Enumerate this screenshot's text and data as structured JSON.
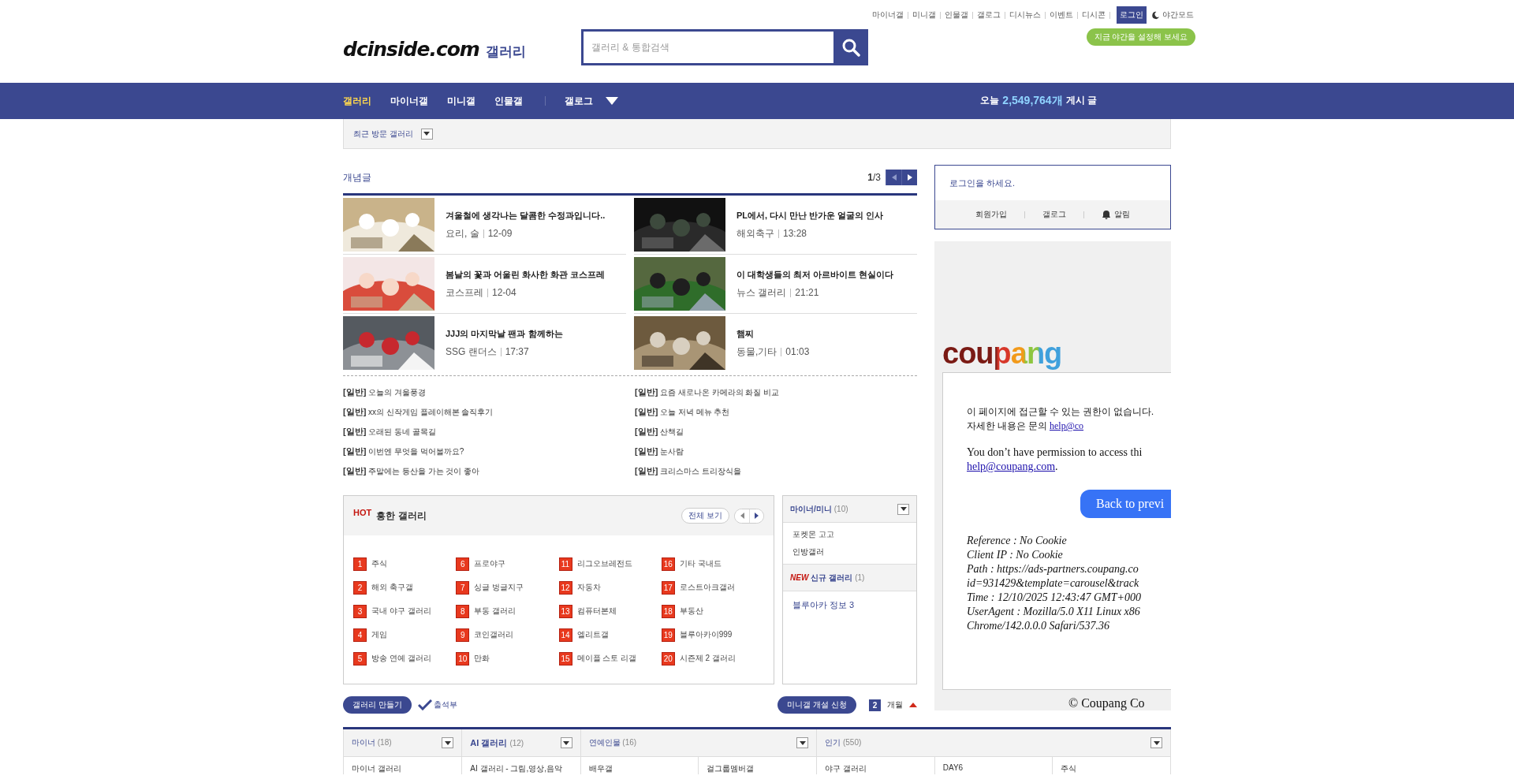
{
  "top_links": [
    "마이너갤",
    "미니갤",
    "인물갤",
    "갤로그",
    "디시뉴스",
    "이벤트",
    "디시콘"
  ],
  "login_button": "로그인",
  "night_mode": {
    "label": "야간모드",
    "on": false
  },
  "tooltip": "지금 야간을 설정해 보세요",
  "logo": {
    "text": "dcinside.com",
    "suffix": "갤러리"
  },
  "search": {
    "placeholder": "갤러리 & 통합검색"
  },
  "nav": {
    "items": [
      {
        "label": "갤러리",
        "selected": true
      },
      {
        "label": "마이너갤",
        "selected": false
      },
      {
        "label": "미니갤",
        "selected": false
      },
      {
        "label": "인물갤",
        "selected": false
      }
    ],
    "more": "갤로그"
  },
  "stats": {
    "prefix": "오늘",
    "count": "2,549,764개",
    "suffix": "게시 글"
  },
  "recent": {
    "label": "최근 방문 갤러리"
  },
  "best": {
    "title": "개념글",
    "page": "1",
    "pages": "/3",
    "cards": [
      {
        "title": "겨울철에 생각나는 달콤한 수정과입니다..",
        "source": "요리, 술",
        "time": "12-09"
      },
      {
        "title": "PL에서, 다시 만난 반가운 얼굴의 인사",
        "source": "해외축구",
        "time": "13:28"
      },
      {
        "title": "봄날의 꽃과 어울린 화사한 화관 코스프레",
        "source": "코스프레",
        "time": "12-04"
      },
      {
        "title": "이 대학생들의 최저 아르바이트 현실이다",
        "source": "뉴스 갤러리",
        "time": "21:21"
      },
      {
        "title": "JJJ의 마지막날 팬과 함께하는",
        "source": "SSG 랜더스",
        "time": "17:37"
      },
      {
        "title": "햄찌",
        "source": "동물,기타",
        "time": "01:03"
      }
    ],
    "headlines": [
      {
        "tag": "[일반]",
        "text": "오늘의 겨울풍경"
      },
      {
        "tag": "[일반]",
        "text": "요즘 새로나온 카메라의 화질 비교"
      },
      {
        "tag": "[일반]",
        "text": "xx의 신작게임 플레이해본 솔직후기"
      },
      {
        "tag": "[일반]",
        "text": "오늘 저녁 메뉴 추천"
      },
      {
        "tag": "[일반]",
        "text": "오래된 동네 골목길"
      },
      {
        "tag": "[일반]",
        "text": "산책길"
      },
      {
        "tag": "[일반]",
        "text": "이번엔 무엇을 먹어볼까요?"
      },
      {
        "tag": "[일반]",
        "text": "눈사람"
      },
      {
        "tag": "[일반]",
        "text": "주말에는 등산을 가는 것이 좋아"
      },
      {
        "tag": "[일반]",
        "text": "크리스마스 트리장식을"
      }
    ]
  },
  "hot": {
    "badge": "HOT",
    "title": "흥한 갤러리",
    "all_button": "전체 보기",
    "items": [
      {
        "rank": "1",
        "name": "주식"
      },
      {
        "rank": "2",
        "name": "해외 축구갤"
      },
      {
        "rank": "3",
        "name": "국내 야구 갤러리"
      },
      {
        "rank": "4",
        "name": "게임"
      },
      {
        "rank": "5",
        "name": "방송 연예 갤러리"
      },
      {
        "rank": "6",
        "name": "프로야구"
      },
      {
        "rank": "7",
        "name": "싱글 벙글지구"
      },
      {
        "rank": "8",
        "name": "부동 갤러리"
      },
      {
        "rank": "9",
        "name": "코인갤러리"
      },
      {
        "rank": "10",
        "name": "만화"
      },
      {
        "rank": "11",
        "name": "리그오브레전드"
      },
      {
        "rank": "12",
        "name": "자동차"
      },
      {
        "rank": "13",
        "name": "컴퓨터본체"
      },
      {
        "rank": "14",
        "name": "엘리트갤"
      },
      {
        "rank": "15",
        "name": "메이플 스토 리갤"
      },
      {
        "rank": "16",
        "name": "기타 국내드"
      },
      {
        "rank": "17",
        "name": "로스트아크갤러"
      },
      {
        "rank": "18",
        "name": "부동산"
      },
      {
        "rank": "19",
        "name": "블루아카이999"
      },
      {
        "rank": "20",
        "name": "시즌제 2 갤러리"
      }
    ]
  },
  "minor": {
    "title": "마이너/미니",
    "count": "(10)",
    "items": [
      "포켓몬 고고",
      "인방갤러"
    ]
  },
  "newgal": {
    "badge": "NEW",
    "title": "신규 갤러리",
    "count": "(1)",
    "items": [
      "블루아카 정보 3"
    ]
  },
  "login": {
    "message": "로그인을 하세요.",
    "links": [
      {
        "label": "회원가입",
        "kind": "text"
      },
      {
        "label": "갤로그",
        "kind": "text"
      },
      {
        "label": "알림",
        "kind": "bell"
      }
    ]
  },
  "ad": {
    "logo": "coupang",
    "notice": "이 페이지에 접근할 수 있는 권한이 없습니다. 자세한 내용은 문의 ",
    "notice_link": "help@co",
    "english": "You don’t have permission to access thi",
    "english_link": "help@coupang.com",
    "english_end": ".",
    "button": "Back to previ",
    "details": [
      "Reference : No Cookie",
      "Client IP : No Cookie",
      "Path : https://ads-partners.coupang.co",
      "id=931429&template=carousel&track",
      "Time : 12/10/2025 12:43:47 GMT+000",
      "UserAgent : Mozilla/5.0 X11 Linux x86",
      "Chrome/142.0.0.0 Safari/537.36"
    ],
    "footer": "© Coupang Co"
  },
  "actions": {
    "create": "갤러리 만들기",
    "attendance": "출석부",
    "apply": "미니갤 개설 신청",
    "badge": "2",
    "badge_label": "개월"
  },
  "categories": [
    {
      "title": "마이너",
      "bold": false,
      "count": "(18)",
      "cells": [
        "마이너 갤러리"
      ]
    },
    {
      "title": "AI 갤러리",
      "bold": true,
      "count": "(12)",
      "cells": [
        "AI 갤러리 - 그림,영상,음악"
      ]
    },
    {
      "title": "연예인물",
      "bold": false,
      "count": "(16)",
      "cells": [
        "배우갤",
        "걸그룹멤버갤"
      ]
    },
    {
      "title": "인기",
      "bold": false,
      "count": "(550)",
      "cells": [
        "야구 갤러리",
        "DAY6",
        "주식"
      ]
    }
  ]
}
